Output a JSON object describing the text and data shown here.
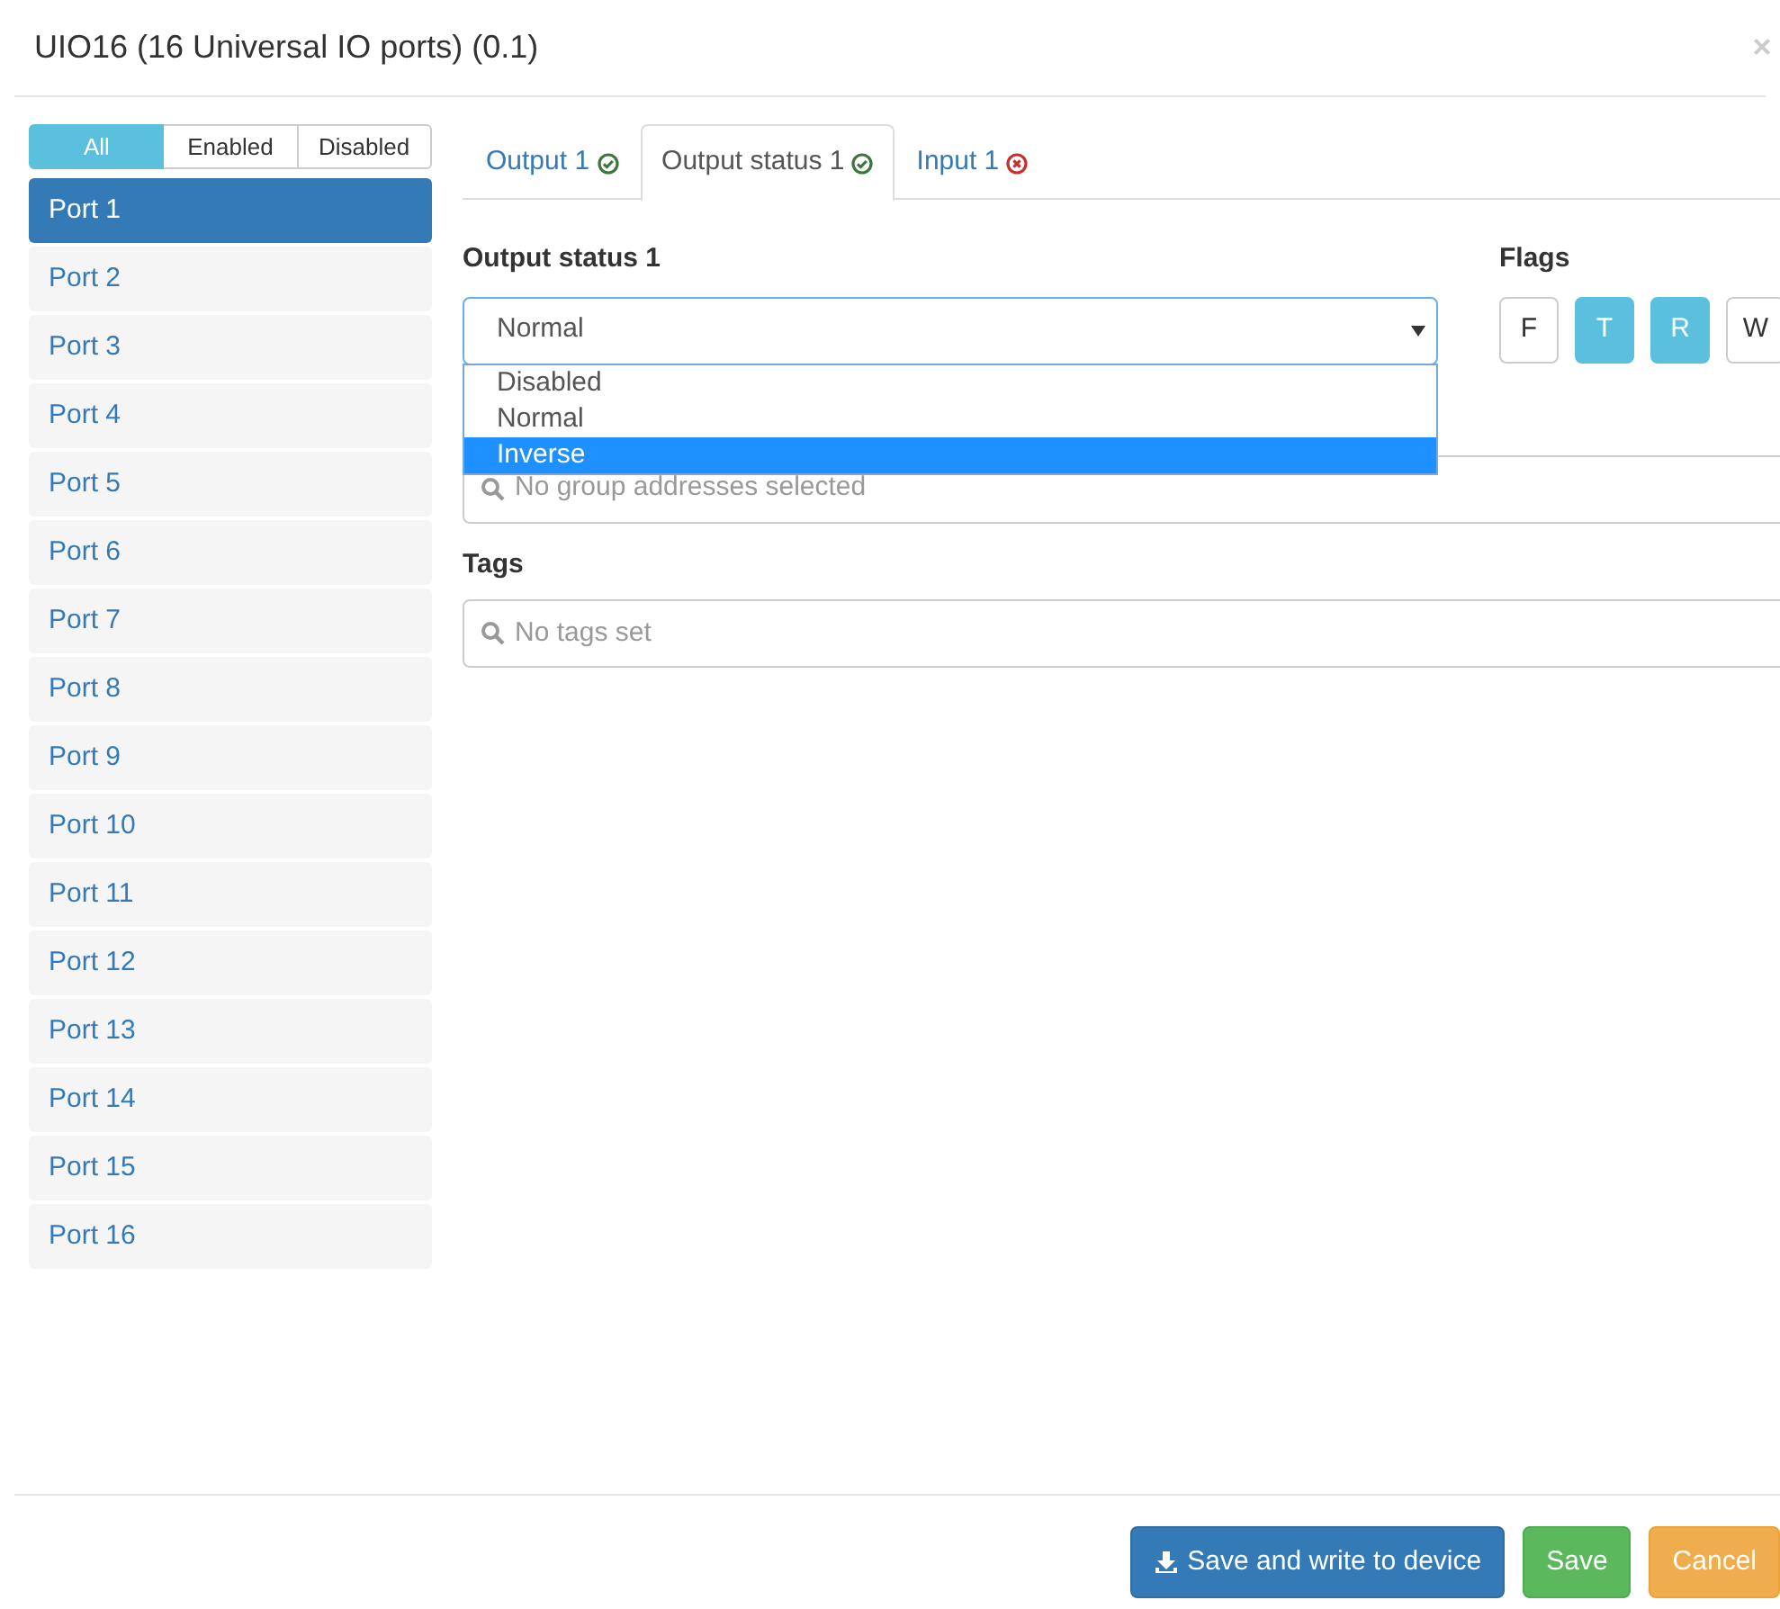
{
  "window": {
    "title": "UIO16 (16 Universal IO ports) (0.1)",
    "close": "×"
  },
  "filter": [
    {
      "label": "All",
      "selected": true
    },
    {
      "label": "Enabled",
      "selected": false
    },
    {
      "label": "Disabled",
      "selected": false
    }
  ],
  "ports": [
    {
      "label": "Port 1",
      "selected": true
    },
    {
      "label": "Port 2",
      "selected": false
    },
    {
      "label": "Port 3",
      "selected": false
    },
    {
      "label": "Port 4",
      "selected": false
    },
    {
      "label": "Port 5",
      "selected": false
    },
    {
      "label": "Port 6",
      "selected": false
    },
    {
      "label": "Port 7",
      "selected": false
    },
    {
      "label": "Port 8",
      "selected": false
    },
    {
      "label": "Port 9",
      "selected": false
    },
    {
      "label": "Port 10",
      "selected": false
    },
    {
      "label": "Port 11",
      "selected": false
    },
    {
      "label": "Port 12",
      "selected": false
    },
    {
      "label": "Port 13",
      "selected": false
    },
    {
      "label": "Port 14",
      "selected": false
    },
    {
      "label": "Port 15",
      "selected": false
    },
    {
      "label": "Port 16",
      "selected": false
    }
  ],
  "tabs": [
    {
      "label": "Output 1",
      "selected": false,
      "valid": true
    },
    {
      "label": "Output status 1",
      "selected": true,
      "valid": true
    },
    {
      "label": "Input 1",
      "selected": false,
      "valid": false
    }
  ],
  "mode": {
    "label": "Output status 1",
    "value": "Normal",
    "expanded": true,
    "options": [
      {
        "label": "Disabled",
        "highlighted": false
      },
      {
        "label": "Normal",
        "highlighted": false
      },
      {
        "label": "Inverse",
        "highlighted": true
      }
    ]
  },
  "flags": {
    "label": "Flags",
    "items": [
      {
        "label": "F",
        "selected": false
      },
      {
        "label": "T",
        "selected": true
      },
      {
        "label": "R",
        "selected": true
      },
      {
        "label": "W",
        "selected": false
      }
    ]
  },
  "group_addresses": {
    "placeholder": "No group addresses selected"
  },
  "tags": {
    "label": "Tags",
    "placeholder": "No tags set"
  },
  "footer": [
    {
      "label": "Save and write to device",
      "kind": "primary",
      "icon": true
    },
    {
      "label": "Save",
      "kind": "success"
    },
    {
      "label": "Cancel",
      "kind": "warning"
    }
  ]
}
